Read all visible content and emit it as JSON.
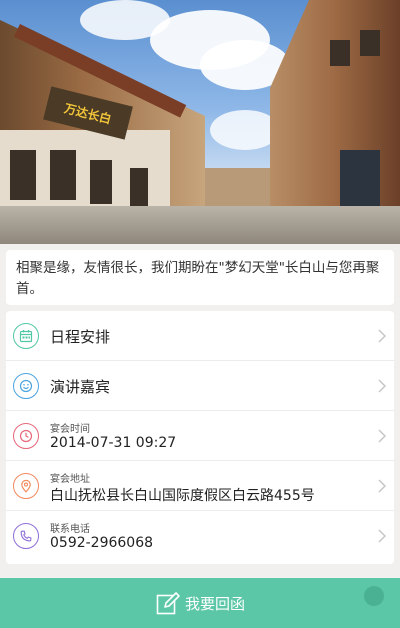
{
  "hero": {
    "sign_text": "万达长白"
  },
  "message": {
    "text": "相聚是缘，友情很长，我们期盼在\"梦幻天堂\"长白山与您再聚首。"
  },
  "list": {
    "items": [
      {
        "kind": "link",
        "icon": "calendar-icon",
        "color": "#52c7a6",
        "label": "日程安排"
      },
      {
        "kind": "link",
        "icon": "smile-icon",
        "color": "#4aa3df",
        "label": "演讲嘉宾"
      },
      {
        "kind": "detail",
        "icon": "clock-icon",
        "color": "#e5677a",
        "sub": "宴会时间",
        "value": "2014-07-31 09:27"
      },
      {
        "kind": "detail",
        "icon": "location-pin-icon",
        "color": "#f08a5d",
        "sub": "宴会地址",
        "value": "白山抚松县长白山国际度假区白云路455号"
      },
      {
        "kind": "detail",
        "icon": "phone-icon",
        "color": "#8e6fd6",
        "sub": "联系电话",
        "value": "0592-2966068"
      }
    ]
  },
  "bottom": {
    "rsvp_label": "我要回函",
    "accent": "#5bc7a6"
  }
}
